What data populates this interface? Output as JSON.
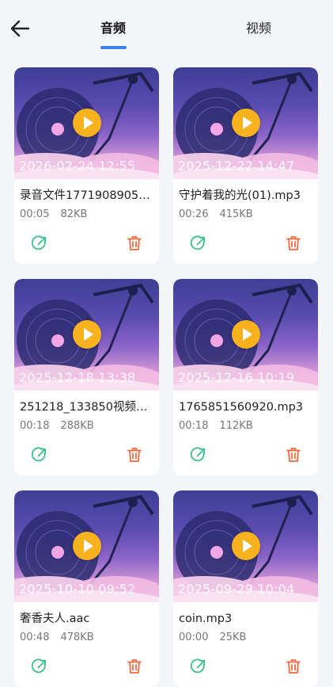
{
  "header": {
    "back_icon": "arrow-left-icon",
    "tabs": [
      {
        "label": "音频",
        "active": true
      },
      {
        "label": "视频",
        "active": false
      }
    ],
    "accent_color": "#3b7ff0"
  },
  "cards": [
    {
      "timestamp": "2026-02-24 12:55",
      "title": "录音文件1771908905…",
      "duration": "00:05",
      "size": "82KB"
    },
    {
      "timestamp": "2025-12-22 14:47",
      "title": "守护着我的光(01).mp3",
      "duration": "00:26",
      "size": "415KB"
    },
    {
      "timestamp": "2025-12-18 13:38",
      "title": "251218_133850视频…",
      "duration": "00:18",
      "size": "288KB"
    },
    {
      "timestamp": "2025-12-16 10:19",
      "title": "1765851560920.mp3",
      "duration": "00:18",
      "size": "112KB"
    },
    {
      "timestamp": "2025-10-10 09:52",
      "title": "奢香夫人.aac",
      "duration": "00:48",
      "size": "478KB"
    },
    {
      "timestamp": "2025-09-29 10:04",
      "title": "coin.mp3",
      "duration": "00:00",
      "size": "25KB"
    }
  ],
  "icons": {
    "play": "play-icon",
    "share": "share-icon",
    "delete": "trash-icon"
  },
  "colors": {
    "play_button": "#f7b21e",
    "share_icon": "#3cc08a",
    "delete_icon": "#f06a3f"
  }
}
